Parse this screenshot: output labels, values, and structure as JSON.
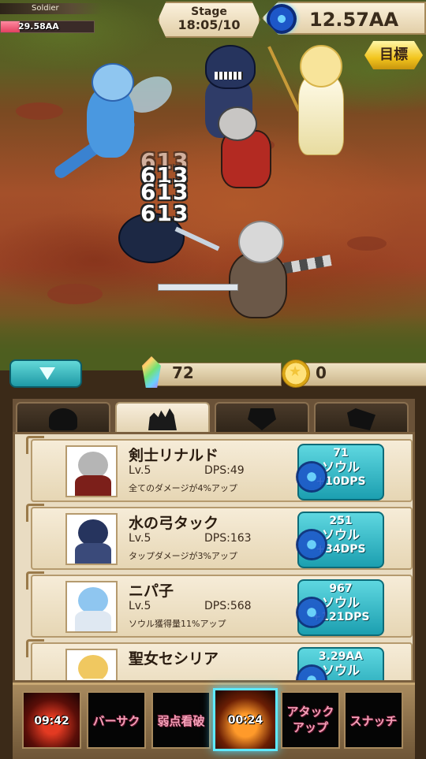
{
  "enemy": {
    "name": "Soldier",
    "hp_text": "29.58AA",
    "hp_fraction": 0.2
  },
  "stage": {
    "label": "Stage",
    "value": "18:05/10"
  },
  "soul": {
    "value": "12.57AA",
    "icon": "soul-orb-icon"
  },
  "goal_button": {
    "label": "目標"
  },
  "damage_numbers": [
    "613",
    "613",
    "613",
    "613"
  ],
  "currencies": {
    "gems": "72",
    "gold": "0"
  },
  "tabs": [
    {
      "icon": "hero-silhouette-icon",
      "active": false
    },
    {
      "icon": "party-icon",
      "active": true
    },
    {
      "icon": "shield-icon",
      "active": false
    },
    {
      "icon": "crystal-icon",
      "active": false
    }
  ],
  "heroes": [
    {
      "name": "剣士リナルド",
      "level": "Lv.5",
      "dps": "DPS:49",
      "desc": "全てのダメージが4%アップ",
      "cost": "71",
      "currency_label": "ソウル",
      "gain": "+10DPS",
      "color": "#7c1f1a"
    },
    {
      "name": "水の弓タック",
      "level": "Lv.5",
      "dps": "DPS:163",
      "desc": "タップダメージが3%アップ",
      "cost": "251",
      "currency_label": "ソウル",
      "gain": "+34DPS",
      "color": "#26345e"
    },
    {
      "name": "ニパ子",
      "level": "Lv.5",
      "dps": "DPS:568",
      "desc": "ソウル獲得量11%アップ",
      "cost": "967",
      "currency_label": "ソウル",
      "gain": "+121DPS",
      "color": "#4a98e0"
    },
    {
      "name": "聖女セシリア",
      "level": "",
      "dps": "",
      "desc": "",
      "cost": "3.29AA",
      "currency_label": "ソウル",
      "gain": "",
      "color": "#f0c860"
    }
  ],
  "skills": [
    {
      "label": "",
      "timer": "09:42"
    },
    {
      "label": "バーサク",
      "timer": ""
    },
    {
      "label": "弱点看破",
      "timer": ""
    },
    {
      "label": "",
      "timer": "00:24"
    },
    {
      "label": "アタック\nアップ",
      "timer": ""
    },
    {
      "label": "スナッチ",
      "timer": ""
    }
  ]
}
